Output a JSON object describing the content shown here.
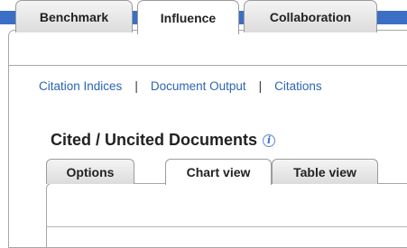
{
  "main_tabs": [
    {
      "label": "Benchmark",
      "active": false
    },
    {
      "label": "Influence",
      "active": true
    },
    {
      "label": "Collaboration",
      "active": false
    }
  ],
  "sub_nav": {
    "links": [
      "Citation Indices",
      "Document Output",
      "Citations"
    ],
    "separator": "|"
  },
  "section": {
    "title": "Cited / Uncited Documents",
    "info_glyph": "i"
  },
  "view_tabs": [
    {
      "label": "Options",
      "active": false
    },
    {
      "label": "Chart view",
      "active": true
    },
    {
      "label": "Table view",
      "active": false
    }
  ],
  "colors": {
    "top_bar": "#3b6fc5",
    "link": "#2a65b3",
    "border": "#a7a7a7"
  }
}
